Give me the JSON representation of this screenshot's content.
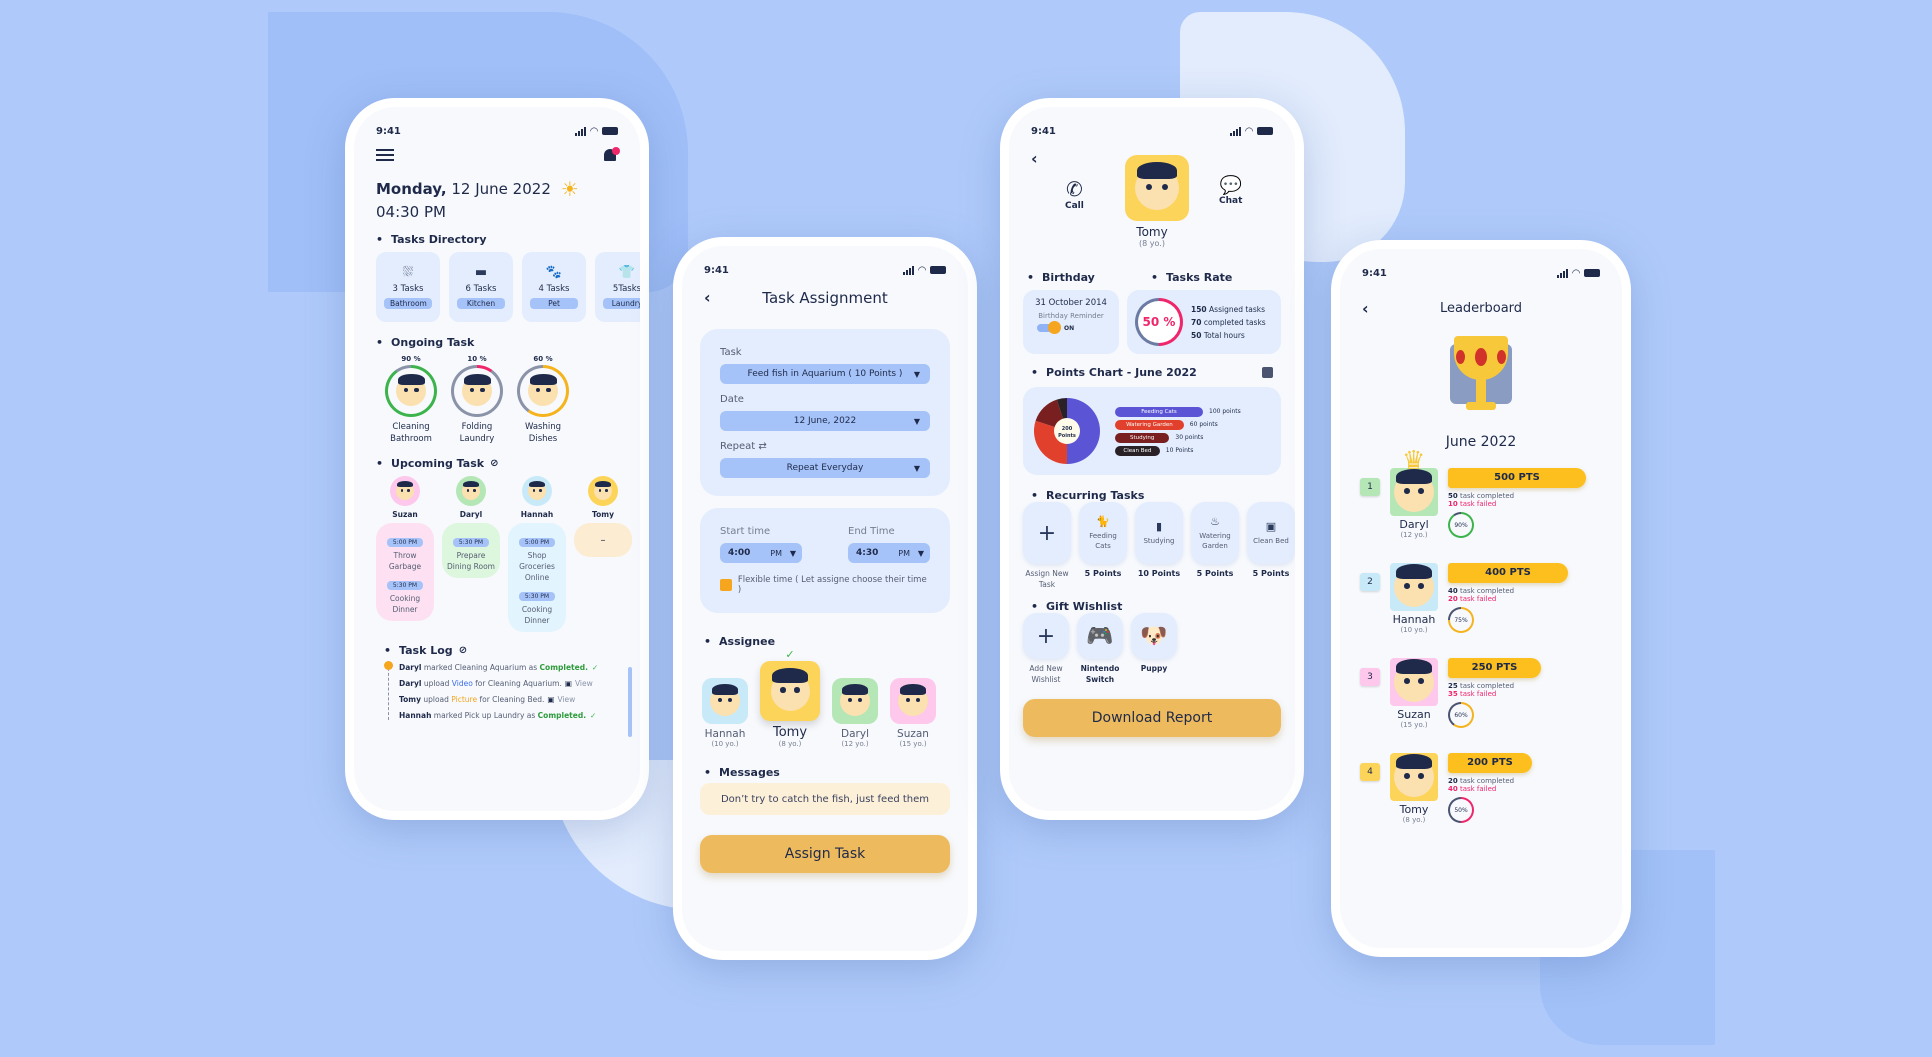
{
  "colors": {
    "background": "#afcafa",
    "accent_yellow": "#eeba5e",
    "accent_blue": "#a5c3f8",
    "danger": "#f0266b",
    "success": "#3cb44b"
  },
  "status_bar": {
    "time": "9:41"
  },
  "dashboard": {
    "day": "Monday,",
    "date": " 12 June 2022",
    "time": "04:30 PM",
    "weather_icon": "sun-icon",
    "notification_icon": "bell-icon",
    "tasks_directory": {
      "title": "Tasks Directory",
      "items": [
        {
          "count": "3 Tasks",
          "label": "Bathroom",
          "icon": "shower-icon"
        },
        {
          "count": "6 Tasks",
          "label": "Kitchen",
          "icon": "pot-icon"
        },
        {
          "count": "4 Tasks",
          "label": "Pet",
          "icon": "paw-icon"
        },
        {
          "count": "5Tasks",
          "label": "Laundry",
          "icon": "shirt-icon"
        }
      ]
    },
    "ongoing": {
      "title": "Ongoing Task",
      "items": [
        {
          "percent": "90 %",
          "progress": 90,
          "label": "Cleaning Bathroom",
          "ring": "#3cb44b",
          "avatar_bg": "#fbe0b0"
        },
        {
          "percent": "10 %",
          "progress": 10,
          "label": "Folding Laundry",
          "ring": "#f0266b",
          "avatar_bg": "#ffffff"
        },
        {
          "percent": "60 %",
          "progress": 60,
          "label": "Washing Dishes",
          "ring": "#f5b41e",
          "avatar_bg": "#fbe0b0"
        }
      ]
    },
    "upcoming": {
      "title": "Upcoming Task",
      "people": [
        {
          "name": "Suzan",
          "bg": "#fdc8ec",
          "card": "#fde1f2",
          "tasks": [
            {
              "time": "5:00 PM",
              "task": "Throw Garbage"
            },
            {
              "time": "5:30 PM",
              "task": "Cooking Dinner"
            }
          ]
        },
        {
          "name": "Daryl",
          "bg": "#b4e6b6",
          "card": "#ddf7de",
          "tasks": [
            {
              "time": "5:30 PM",
              "task": "Prepare Dining Room"
            }
          ]
        },
        {
          "name": "Hannah",
          "bg": "#c8eaf8",
          "card": "#e2f4fd",
          "tasks": [
            {
              "time": "5:00 PM",
              "task": "Shop Groceries Online"
            },
            {
              "time": "5:30 PM",
              "task": "Cooking Dinner"
            }
          ]
        },
        {
          "name": "Tomy",
          "bg": "#fdd45a",
          "card": "#fcecd2",
          "tasks": [],
          "empty": "–"
        }
      ]
    },
    "task_log": {
      "title": "Task Log",
      "entries": [
        {
          "who": "Daryl",
          "text": " marked Cleaning Aquarium as ",
          "hl": "Completed.",
          "hl_color": "#2e9b3b",
          "suffix": "",
          "icon": "check"
        },
        {
          "who": "Daryl",
          "text": " upload ",
          "hl": "Video",
          "hl_color": "#3d6ee8",
          "suffix": " for Cleaning Aquarium.",
          "icon": "video",
          "view": "View"
        },
        {
          "who": "Tomy",
          "text": " upload ",
          "hl": "Picture",
          "hl_color": "#f5a51e",
          "suffix": " for Cleaning Bed.",
          "icon": "image",
          "view": "View"
        },
        {
          "who": "Hannah",
          "text": " marked Pick up Laundry as ",
          "hl": "Completed.",
          "hl_color": "#2e9b3b",
          "suffix": "",
          "icon": "check"
        }
      ]
    }
  },
  "assignment": {
    "title": "Task Assignment",
    "task_label": "Task",
    "task_value": "Feed fish in Aquarium ( 10 Points )",
    "date_label": "Date",
    "date_value": "12 June, 2022",
    "repeat_label": "Repeat",
    "repeat_value": "Repeat Everyday",
    "start_label": "Start time",
    "start_value": "4:00",
    "start_ampm": "PM",
    "end_label": "End Time",
    "end_value": "4:30",
    "end_ampm": "PM",
    "flexible_label": "Flexible time ( Let assigne choose their time )",
    "assignee_title": "Assignee",
    "assignees": [
      {
        "name": "Hannah",
        "age": "(10 yo.)",
        "bg": "#c8eaf8",
        "selected": false
      },
      {
        "name": "Tomy",
        "age": "(8 yo.)",
        "bg": "#fdd45a",
        "selected": true
      },
      {
        "name": "Daryl",
        "age": "(12 yo.)",
        "bg": "#b4e6b6",
        "selected": false
      },
      {
        "name": "Suzan",
        "age": "(15 yo.)",
        "bg": "#fdc8ec",
        "selected": false
      }
    ],
    "messages_title": "Messages",
    "message": "Don’t try to catch the fish, just feed them",
    "assign_button": "Assign Task"
  },
  "profile": {
    "name": "Tomy",
    "age": "(8 yo.)",
    "call_label": "Call",
    "chat_label": "Chat",
    "birthday_title": "Birthday",
    "birthday": "31 October 2014",
    "reminder_label": "Birthday Reminder",
    "reminder_state": "ON",
    "rate_title": "Tasks Rate",
    "rate": "50 %",
    "rate_value": 50,
    "assigned": "150",
    "assigned_label": " Assigned tasks",
    "completed": "70",
    "completed_label": " completed tasks",
    "hours": "50",
    "hours_label": " Total hours",
    "points_title": "Points Chart - June 2022",
    "total_points": "200",
    "total_label": "Points",
    "recurring_title": "Recurring Tasks",
    "recurring": [
      {
        "label": "Assign New Task",
        "points": "",
        "icon": "plus-icon",
        "add": true
      },
      {
        "label": "Feeding Cats",
        "points": "5 Points",
        "icon": "cat-icon"
      },
      {
        "label": "Studying",
        "points": "10 Points",
        "icon": "book-icon"
      },
      {
        "label": "Watering Garden",
        "points": "5 Points",
        "icon": "plant-icon"
      },
      {
        "label": "Clean Bed",
        "points": "5 Points",
        "icon": "bed-icon"
      }
    ],
    "wishlist_title": "Gift Wishlist",
    "wishlist": [
      {
        "label": "Add New Wishlist",
        "icon": "plus-icon",
        "add": true
      },
      {
        "label": "Nintendo Switch",
        "icon": "console-icon"
      },
      {
        "label": "Puppy",
        "icon": "puppy-icon"
      }
    ],
    "download_button": "Download Report"
  },
  "leaderboard": {
    "title": "Leaderboard",
    "period": "June 2022",
    "entries": [
      {
        "rank": "1",
        "name": "Daryl",
        "age": "(12 yo.)",
        "points": "500 PTS",
        "completed": "50",
        "failed": "10",
        "rate": "90%",
        "rate_value": 90,
        "ring": "#3cb44b",
        "rank_bg": "#b4e6b6",
        "bg": "#b4e6b6",
        "bar_pct": 100
      },
      {
        "rank": "2",
        "name": "Hannah",
        "age": "(10 yo.)",
        "points": "400 PTS",
        "completed": "40",
        "failed": "20",
        "rate": "75%",
        "rate_value": 75,
        "ring": "#f5b41e",
        "rank_bg": "#c8eaf8",
        "bg": "#c8eaf8",
        "bar_pct": 80
      },
      {
        "rank": "3",
        "name": "Suzan",
        "age": "(15 yo.)",
        "points": "250 PTS",
        "completed": "25",
        "failed": "35",
        "rate": "60%",
        "rate_value": 60,
        "ring": "#f5b41e",
        "rank_bg": "#fdc8ec",
        "bg": "#fdc8ec",
        "bar_pct": 50
      },
      {
        "rank": "4",
        "name": "Tomy",
        "age": "(8 yo.)",
        "points": "200 PTS",
        "completed": "20",
        "failed": "40",
        "rate": "50%",
        "rate_value": 50,
        "ring": "#f0266b",
        "rank_bg": "#fdd45a",
        "bg": "#fdd45a",
        "bar_pct": 40
      }
    ],
    "completed_label": " task completed",
    "failed_label": " task failed"
  },
  "chart_data": {
    "type": "pie",
    "title": "Points Chart - June 2022",
    "categories": [
      "Feeding Cats",
      "Watering Garden",
      "Studying",
      "Clean Bed"
    ],
    "values": [
      100,
      60,
      30,
      10
    ],
    "value_labels": [
      "100 points",
      "60 points",
      "30 points",
      "10 Points"
    ],
    "colors": [
      "#5b55d6",
      "#e0402c",
      "#7a1f1f",
      "#2a2126"
    ],
    "center_label": "200 Points",
    "legend": "right"
  }
}
